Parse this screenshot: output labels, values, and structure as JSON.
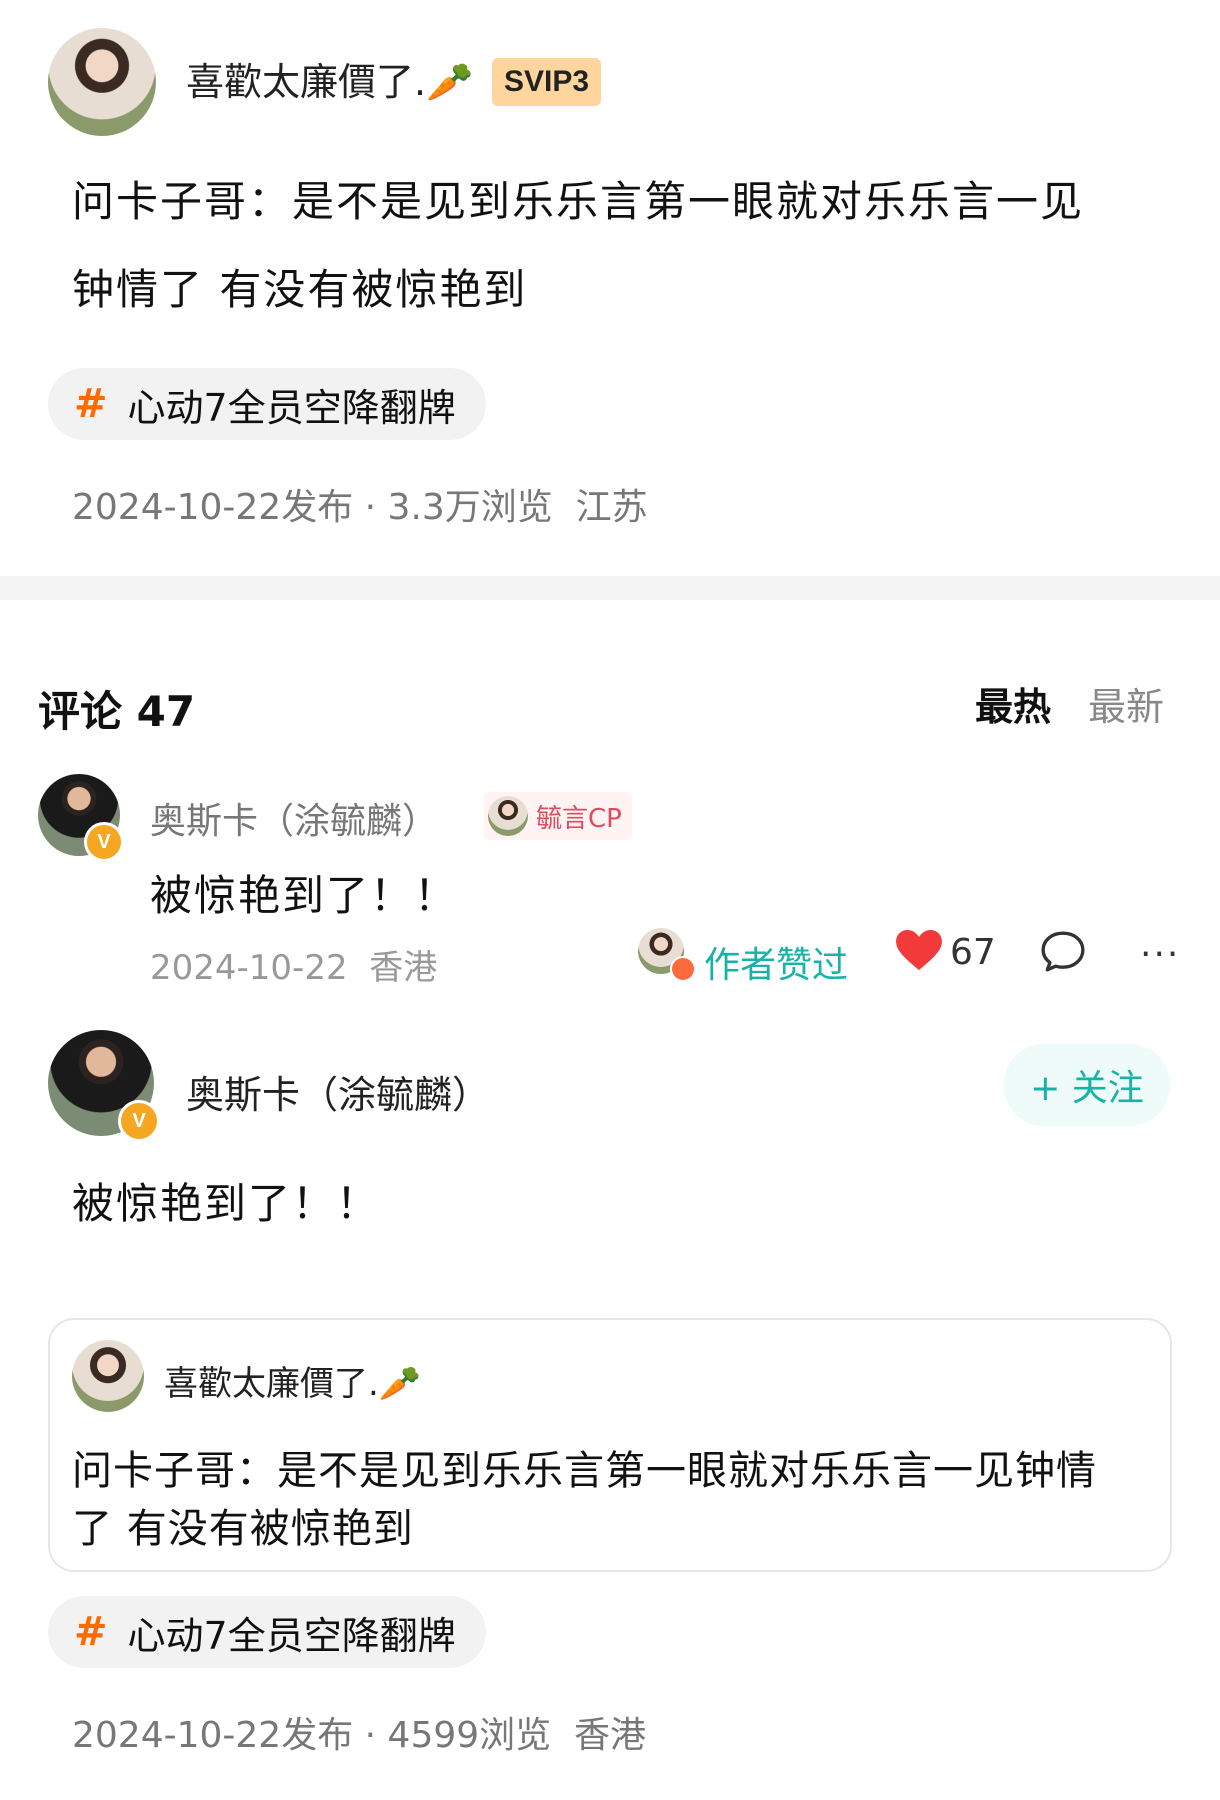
{
  "post": {
    "author": "喜歡太廉價了.",
    "author_emoji": "🥕",
    "badge": "SVIP3",
    "text_line1": "问卡子哥：是不是见到乐乐言第一眼就对乐乐言一见",
    "text_line2": "钟情了 有没有被惊艳到",
    "topic": "心动7全员空降翻牌",
    "meta": "2024-10-22发布 · 3.3万浏览  江苏"
  },
  "comments_header": {
    "title": "评论 47",
    "sort_hot": "最热",
    "sort_new": "最新"
  },
  "comment": {
    "author": "奥斯卡（涂毓麟）",
    "tag": "毓言CP",
    "text": "被惊艳到了！！",
    "date_loc": "2024-10-22  香港",
    "author_liked": "作者赞过",
    "likes": "67"
  },
  "repost": {
    "author": "奥斯卡（涂毓麟）",
    "follow_label": "+ 关注",
    "text": "被惊艳到了！！",
    "quoted_author": "喜歡太廉價了.",
    "quoted_emoji": "🥕",
    "quoted_line1": "问卡子哥：是不是见到乐乐言第一眼就对乐乐言一见钟情",
    "quoted_line2": "了 有没有被惊艳到",
    "topic": "心动7全员空降翻牌",
    "meta": "2024-10-22发布 · 4599浏览  香港"
  },
  "colors": {
    "accent_teal": "#18b3a6",
    "hash_orange": "#ff6a00",
    "like_red": "#f23a3a",
    "svip_bg": "#ffd59e"
  }
}
